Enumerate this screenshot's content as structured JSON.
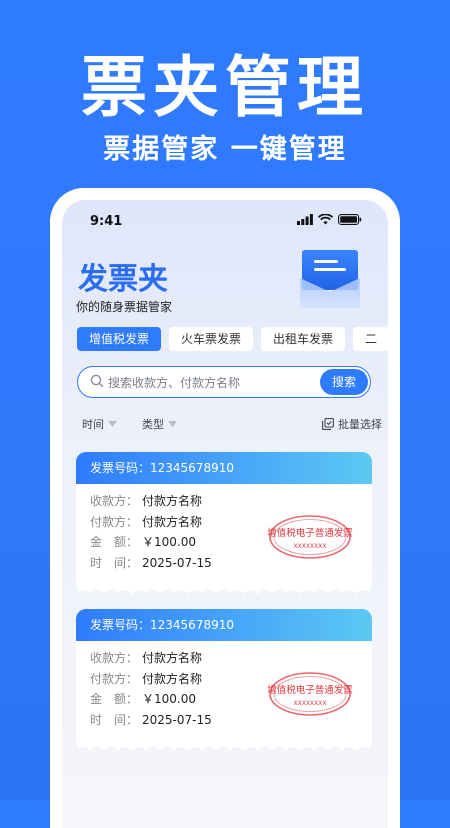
{
  "hero": {
    "title": "票夹管理",
    "subtitle": "票据管家 一键管理"
  },
  "status_bar": {
    "time": "9:41"
  },
  "app": {
    "title": "发票夹",
    "subtitle": "你的随身票据管家"
  },
  "tabs": [
    {
      "label": "增值税发票",
      "active": true
    },
    {
      "label": "火车票发票",
      "active": false
    },
    {
      "label": "出租车发票",
      "active": false
    },
    {
      "label": "二",
      "active": false
    }
  ],
  "search": {
    "placeholder": "搜索收款方、付款方名称",
    "button": "搜索"
  },
  "filters": {
    "time": "时间",
    "type": "类型",
    "batch": "批量选择"
  },
  "invoices": [
    {
      "header": "发票号码：12345678910",
      "rows": [
        {
          "label": "收款方：",
          "value": "付款方名称"
        },
        {
          "label": "付款方：",
          "value": "付款方名称"
        },
        {
          "label": "金　额：",
          "value": "￥100.00"
        },
        {
          "label": "时　间：",
          "value": "2025-07-15"
        }
      ],
      "stamp": {
        "text": "增值税电子普通发票",
        "code": "XXXXXXXX"
      }
    },
    {
      "header": "发票号码：12345678910",
      "rows": [
        {
          "label": "收款方：",
          "value": "付款方名称"
        },
        {
          "label": "付款方：",
          "value": "付款方名称"
        },
        {
          "label": "金　额：",
          "value": "￥100.00"
        },
        {
          "label": "时　间：",
          "value": "2025-07-15"
        }
      ],
      "stamp": {
        "text": "增值税电子普通发票",
        "code": "XXXXXXXX"
      }
    }
  ],
  "colors": {
    "primary": "#2f7bff",
    "stamp": "#e0383e",
    "gradient_end": "#5cc9f2"
  }
}
